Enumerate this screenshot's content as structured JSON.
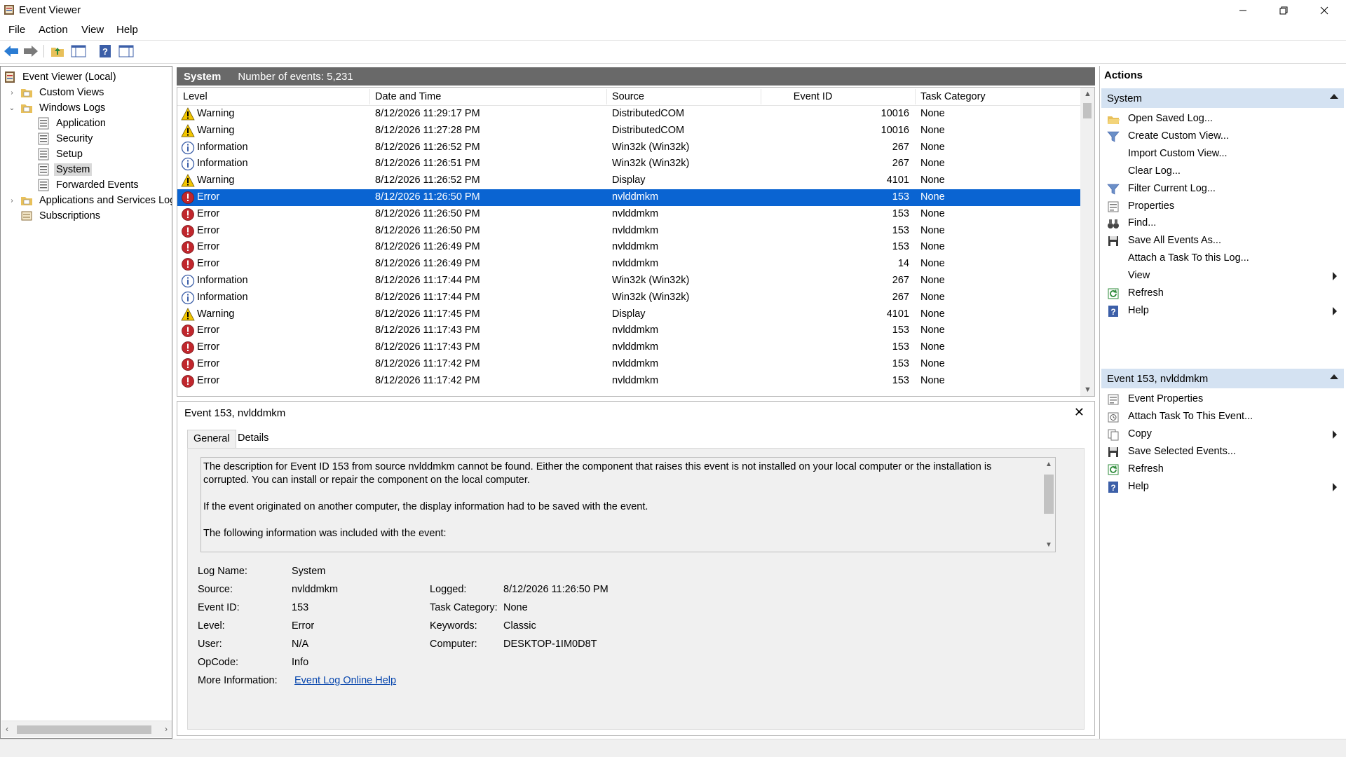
{
  "window": {
    "title": "Event Viewer"
  },
  "menu": [
    "File",
    "Action",
    "View",
    "Help"
  ],
  "toolbar": {
    "buttons": [
      "back-icon",
      "forward-icon",
      "folder-up-icon",
      "console-tree-icon",
      "help-icon",
      "action-pane-icon"
    ]
  },
  "tree": {
    "items": [
      {
        "label": "Event Viewer (Local)",
        "icon": "event-viewer-icon",
        "level": 0,
        "expander": ""
      },
      {
        "label": "Custom Views",
        "icon": "folder-icon",
        "level": 1,
        "expander": "›"
      },
      {
        "label": "Windows Logs",
        "icon": "folder-icon",
        "level": 1,
        "expander": "⌄"
      },
      {
        "label": "Application",
        "icon": "log-icon",
        "level": 2,
        "expander": ""
      },
      {
        "label": "Security",
        "icon": "log-icon",
        "level": 2,
        "expander": ""
      },
      {
        "label": "Setup",
        "icon": "log-icon",
        "level": 2,
        "expander": ""
      },
      {
        "label": "System",
        "icon": "log-icon",
        "level": 2,
        "expander": "",
        "selected": true
      },
      {
        "label": "Forwarded Events",
        "icon": "log-icon",
        "level": 2,
        "expander": ""
      },
      {
        "label": "Applications and Services Logs",
        "icon": "folder-icon",
        "level": 1,
        "expander": "›"
      },
      {
        "label": "Subscriptions",
        "icon": "subscriptions-icon",
        "level": 1,
        "expander": ""
      }
    ]
  },
  "center": {
    "log_name": "System",
    "count_text": "Number of events: 5,231",
    "columns": {
      "level": "Level",
      "datetime": "Date and Time",
      "source": "Source",
      "event_id": "Event ID",
      "task": "Task Category"
    },
    "rows": [
      {
        "level": "Warning",
        "datetime": "8/12/2026 11:29:17 PM",
        "source": "DistributedCOM",
        "event_id": "10016",
        "task": "None"
      },
      {
        "level": "Warning",
        "datetime": "8/12/2026 11:27:28 PM",
        "source": "DistributedCOM",
        "event_id": "10016",
        "task": "None"
      },
      {
        "level": "Information",
        "datetime": "8/12/2026 11:26:52 PM",
        "source": "Win32k (Win32k)",
        "event_id": "267",
        "task": "None"
      },
      {
        "level": "Information",
        "datetime": "8/12/2026 11:26:51 PM",
        "source": "Win32k (Win32k)",
        "event_id": "267",
        "task": "None"
      },
      {
        "level": "Warning",
        "datetime": "8/12/2026 11:26:52 PM",
        "source": "Display",
        "event_id": "4101",
        "task": "None"
      },
      {
        "level": "Error",
        "datetime": "8/12/2026 11:26:50 PM",
        "source": "nvlddmkm",
        "event_id": "153",
        "task": "None",
        "selected": true
      },
      {
        "level": "Error",
        "datetime": "8/12/2026 11:26:50 PM",
        "source": "nvlddmkm",
        "event_id": "153",
        "task": "None"
      },
      {
        "level": "Error",
        "datetime": "8/12/2026 11:26:50 PM",
        "source": "nvlddmkm",
        "event_id": "153",
        "task": "None"
      },
      {
        "level": "Error",
        "datetime": "8/12/2026 11:26:49 PM",
        "source": "nvlddmkm",
        "event_id": "153",
        "task": "None"
      },
      {
        "level": "Error",
        "datetime": "8/12/2026 11:26:49 PM",
        "source": "nvlddmkm",
        "event_id": "14",
        "task": "None"
      },
      {
        "level": "Information",
        "datetime": "8/12/2026 11:17:44 PM",
        "source": "Win32k (Win32k)",
        "event_id": "267",
        "task": "None"
      },
      {
        "level": "Information",
        "datetime": "8/12/2026 11:17:44 PM",
        "source": "Win32k (Win32k)",
        "event_id": "267",
        "task": "None"
      },
      {
        "level": "Warning",
        "datetime": "8/12/2026 11:17:45 PM",
        "source": "Display",
        "event_id": "4101",
        "task": "None"
      },
      {
        "level": "Error",
        "datetime": "8/12/2026 11:17:43 PM",
        "source": "nvlddmkm",
        "event_id": "153",
        "task": "None"
      },
      {
        "level": "Error",
        "datetime": "8/12/2026 11:17:43 PM",
        "source": "nvlddmkm",
        "event_id": "153",
        "task": "None"
      },
      {
        "level": "Error",
        "datetime": "8/12/2026 11:17:42 PM",
        "source": "nvlddmkm",
        "event_id": "153",
        "task": "None"
      },
      {
        "level": "Error",
        "datetime": "8/12/2026 11:17:42 PM",
        "source": "nvlddmkm",
        "event_id": "153",
        "task": "None"
      }
    ]
  },
  "detail": {
    "title": "Event 153, nvlddmkm",
    "tabs": [
      "General",
      "Details"
    ],
    "description": [
      "The description for Event ID 153 from source nvlddmkm cannot be found. Either the component that raises this event is not installed on your local computer or the installation is corrupted. You can install or repair the component on the local computer.",
      "If the event originated on another computer, the display information had to be saved with the event.",
      "The following information was included with the event:"
    ],
    "labels": {
      "log_name": "Log Name:",
      "source": "Source:",
      "event_id": "Event ID:",
      "level": "Level:",
      "user": "User:",
      "opcode": "OpCode:",
      "more_info": "More Information:",
      "logged": "Logged:",
      "task_category": "Task Category:",
      "keywords": "Keywords:",
      "computer": "Computer:"
    },
    "values": {
      "log_name": "System",
      "source": "nvlddmkm",
      "event_id": "153",
      "level": "Error",
      "user": "N/A",
      "opcode": "Info",
      "more_info": "Event Log Online Help",
      "logged": "8/12/2026 11:26:50 PM",
      "task_category": "None",
      "keywords": "Classic",
      "computer": "DESKTOP-1IM0D8T"
    }
  },
  "actions": {
    "header": "Actions",
    "system_section": "System",
    "system_items": [
      {
        "label": "Open Saved Log...",
        "icon": "open-folder-icon",
        "submenu": false
      },
      {
        "label": "Create Custom View...",
        "icon": "filter-icon",
        "submenu": false
      },
      {
        "label": "Import Custom View...",
        "icon": "",
        "submenu": false
      },
      {
        "label": "Clear Log...",
        "icon": "",
        "submenu": false
      },
      {
        "label": "Filter Current Log...",
        "icon": "filter-icon",
        "submenu": false
      },
      {
        "label": "Properties",
        "icon": "properties-icon",
        "submenu": false
      },
      {
        "label": "Find...",
        "icon": "binoculars-icon",
        "submenu": false
      },
      {
        "label": "Save All Events As...",
        "icon": "save-icon",
        "submenu": false
      },
      {
        "label": "Attach a Task To this Log...",
        "icon": "",
        "submenu": false
      },
      {
        "label": "View",
        "icon": "",
        "submenu": true
      },
      {
        "label": "Refresh",
        "icon": "refresh-icon",
        "submenu": false
      },
      {
        "label": "Help",
        "icon": "help-icon",
        "submenu": true
      }
    ],
    "event_section": "Event 153, nvlddmkm",
    "event_items": [
      {
        "label": "Event Properties",
        "icon": "properties-icon",
        "submenu": false
      },
      {
        "label": "Attach Task To This Event...",
        "icon": "task-icon",
        "submenu": false
      },
      {
        "label": "Copy",
        "icon": "copy-icon",
        "submenu": true
      },
      {
        "label": "Save Selected Events...",
        "icon": "save-icon",
        "submenu": false
      },
      {
        "label": "Refresh",
        "icon": "refresh-icon",
        "submenu": false
      },
      {
        "label": "Help",
        "icon": "help-icon",
        "submenu": true
      }
    ]
  },
  "colors": {
    "selection": "#0a64d2",
    "header_bar": "#696969",
    "section_bg": "#d4e2f2",
    "error": "#c0272d",
    "warning": "#f2c500",
    "info": "#3c5fa8"
  }
}
